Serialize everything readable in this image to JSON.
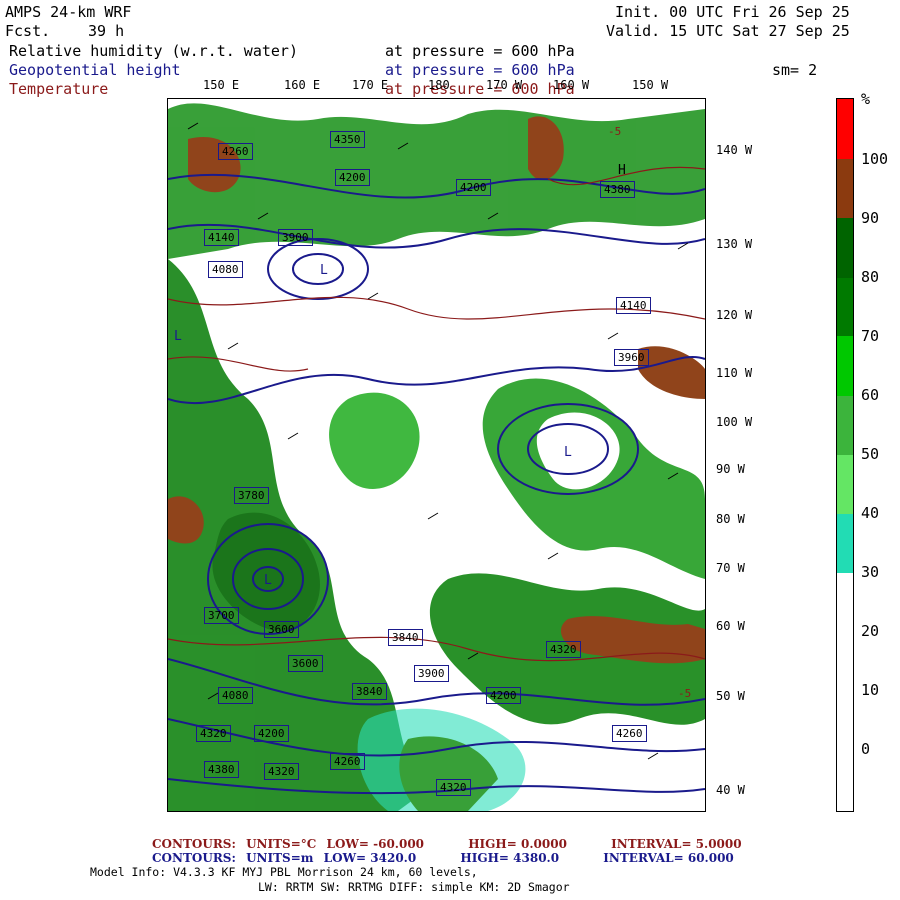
{
  "header": {
    "model": "AMPS 24-km WRF",
    "forecast_label": "Fcst.",
    "forecast_hours": "39 h",
    "init": "Init. 00 UTC Fri 26 Sep 25",
    "valid": "Valid. 15 UTC Sat 27 Sep 25",
    "smoothing": "sm= 2"
  },
  "fields": [
    {
      "name": "Relative humidity (w.r.t. water)",
      "level_text": "at pressure =  600 hPa",
      "color": "#000000"
    },
    {
      "name": "Geopotential height",
      "level_text": "at pressure =  600 hPa",
      "color": "#1a1a8c"
    },
    {
      "name": "Temperature",
      "level_text": "at pressure =  600 hPa",
      "color": "#8b1a1a"
    }
  ],
  "map": {
    "top_longitudes": [
      "150 E",
      "160 E",
      "170 E",
      "180",
      "170 W",
      "160 W",
      "150 W"
    ],
    "right_longitudes": [
      "140 W",
      "130 W",
      "120 W",
      "110 W",
      "100 W",
      "90 W",
      "80 W",
      "70 W",
      "60 W",
      "50 W",
      "40 W"
    ],
    "height_labels": [
      "4260",
      "4350",
      "4200",
      "4200",
      "4380",
      "4080",
      "3900",
      "4140",
      "3960",
      "4140",
      "3780",
      "3840",
      "3600",
      "4080",
      "3700",
      "3600",
      "3840",
      "3900",
      "4200",
      "4320",
      "4200",
      "4320",
      "4260",
      "4380",
      "4320",
      "4260",
      "4320"
    ],
    "high_label": "H",
    "low_labels": [
      "L",
      "L",
      "L",
      "L"
    ],
    "temperature_labels": [
      "-5",
      "-5"
    ]
  },
  "colorbar": {
    "unit": "%",
    "ticks": [
      "100",
      "90",
      "80",
      "70",
      "60",
      "50",
      "40",
      "30",
      "20",
      "10",
      "0"
    ],
    "colors": [
      "#ff0000",
      "#8b3a0f",
      "#006400",
      "#007a00",
      "#00c800",
      "#3cb43c",
      "#64e664",
      "#22dcb4",
      "#ffffff",
      "#ffffff"
    ]
  },
  "footer": {
    "temp_contours": {
      "label": "CONTOURS:",
      "units": "UNITS=°C",
      "low": "LOW=  -60.000",
      "high": "HIGH=  0.0000",
      "interval": "INTERVAL=   5.0000",
      "color": "#8b1a1a"
    },
    "height_contours": {
      "label": "CONTOURS:",
      "units": "UNITS=m",
      "low": "LOW=  3420.0",
      "high": "HIGH=  4380.0",
      "interval": "INTERVAL=   60.000",
      "color": "#1a1a8c"
    },
    "model_info_1": "Model Info: V4.3.3    KF       MYJ PBL  Morrison         24 km,    60 levels,",
    "model_info_2": "LW: RRTM SW: RRTMG   DIFF: simple KM: 2D Smagor"
  }
}
